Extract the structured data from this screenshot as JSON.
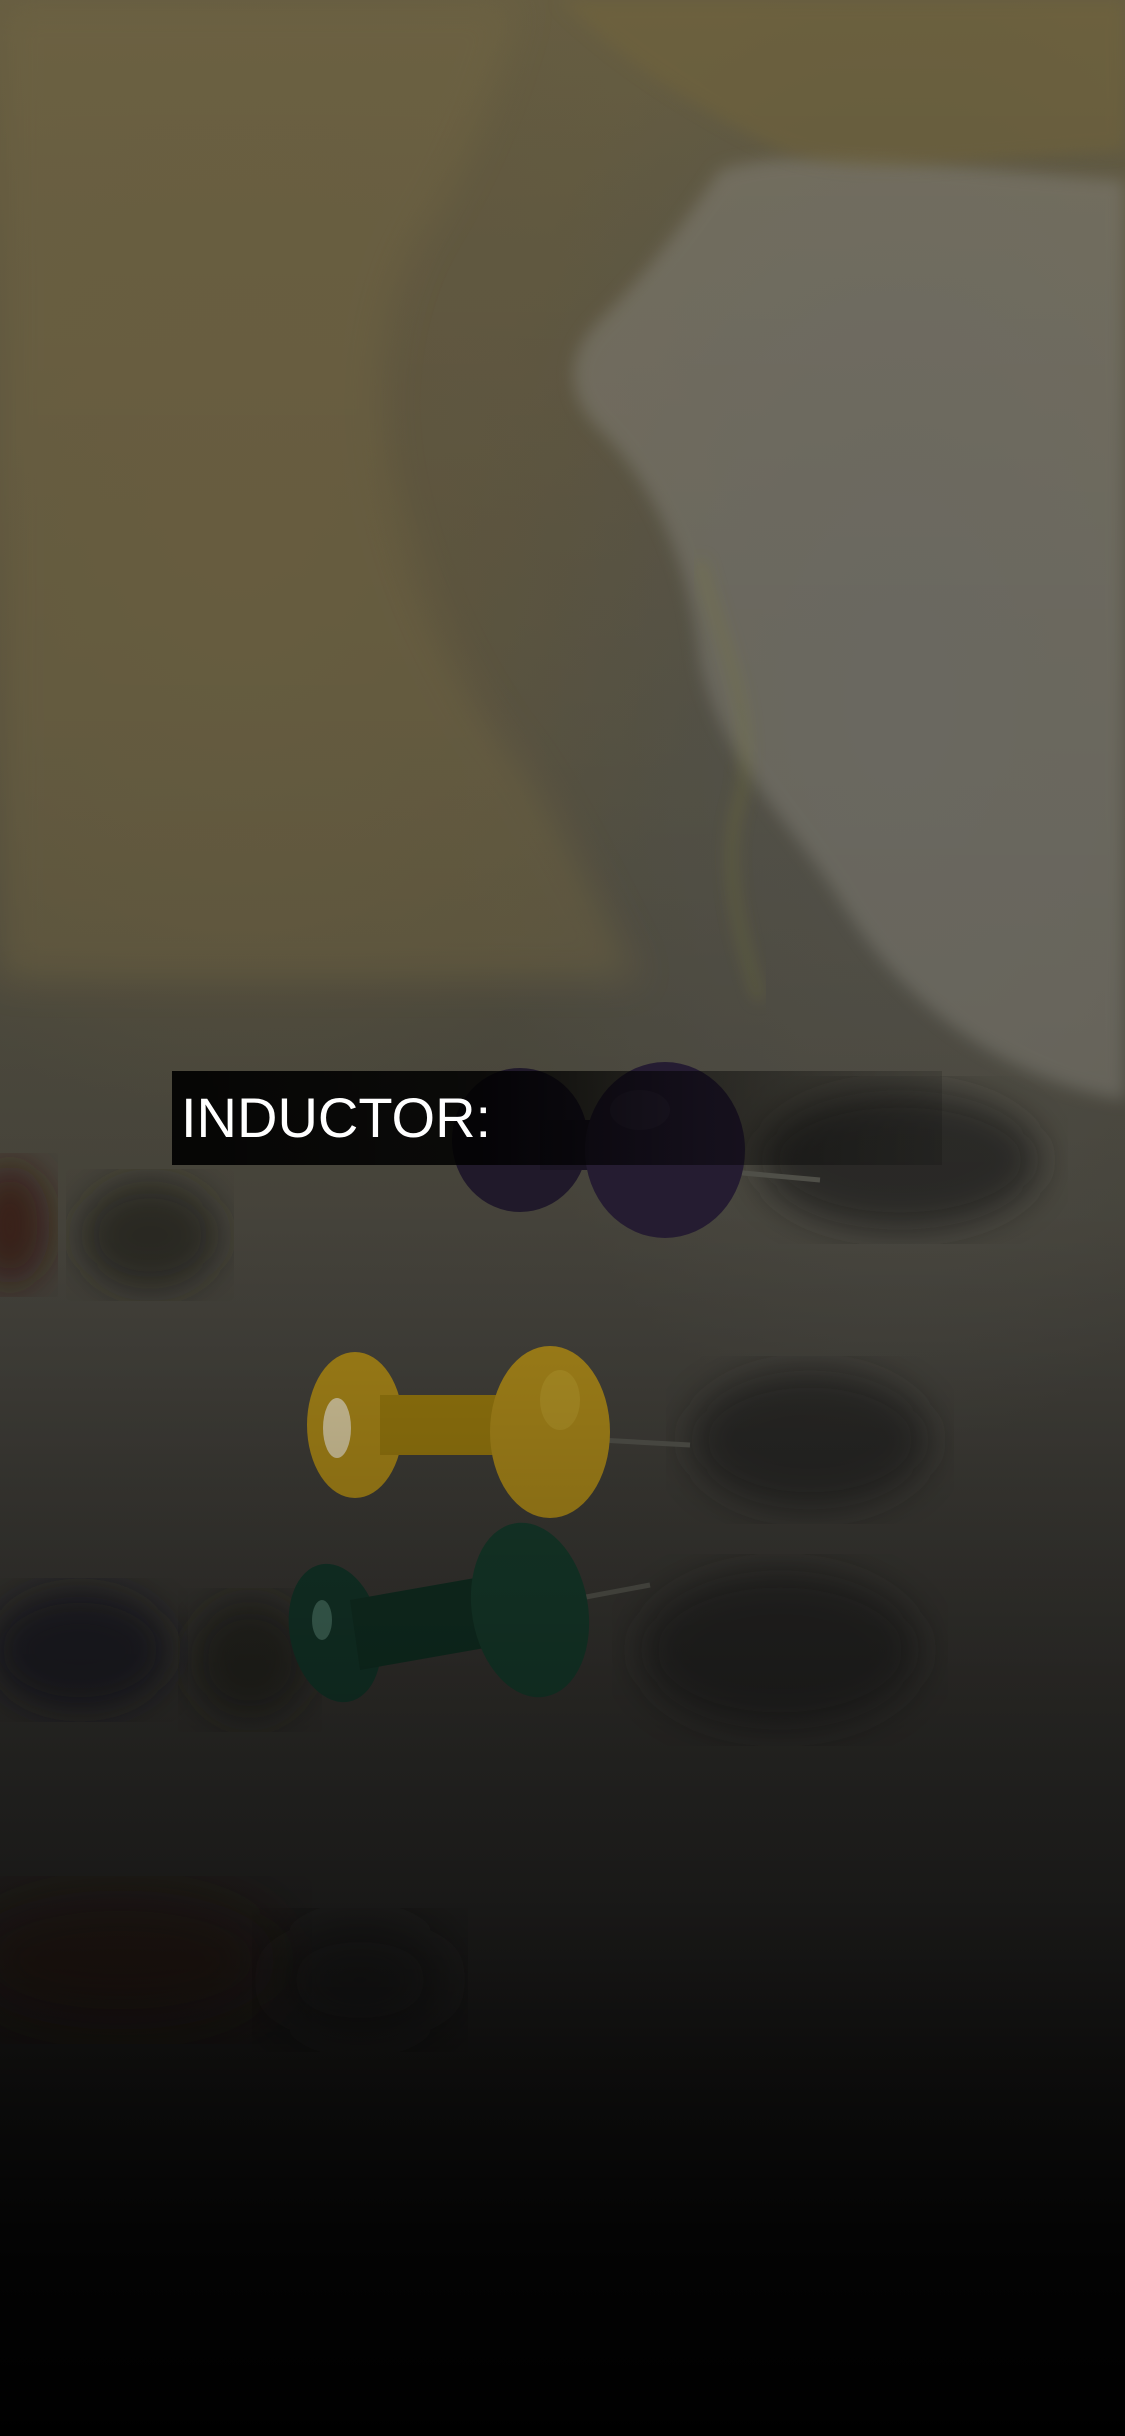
{
  "background": {
    "description_icon": "map-with-pushpins-photo",
    "pin_colors": [
      "#2a2035",
      "#c8a21a",
      "#1f4a3a"
    ]
  },
  "overlay": {
    "label": "INDUCTOR:"
  }
}
